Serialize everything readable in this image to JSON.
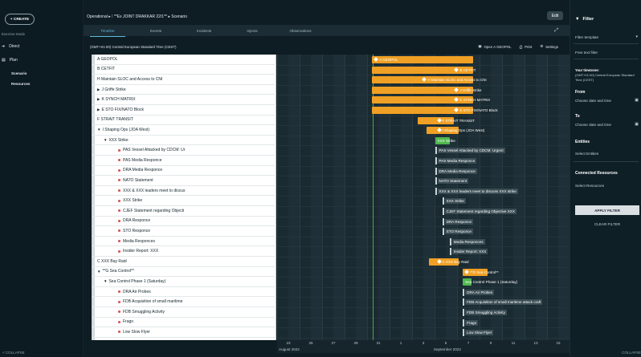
{
  "nav": {
    "create_label": "+ CREATE",
    "exercise_mode": "Exercise Mode",
    "items": [
      {
        "label": "Direct",
        "icon": "arrow-icon"
      },
      {
        "label": "Plan",
        "icon": "clipboard-icon"
      }
    ],
    "sub_items": [
      "Scenario",
      "Resources"
    ],
    "collapse": "< COLLAPSE"
  },
  "header": {
    "breadcrumb": "Operational  ▸  ⁞  **Ex JOINT DRAKKAR 22/1**  ▸  Scenario",
    "edit": "Edit"
  },
  "tabs": [
    "Timeline",
    "Events",
    "Incidents",
    "Injects",
    "Observations"
  ],
  "toolbar": {
    "timezone": "(GMT+01:00) Central European Standard Time (CEST)",
    "open_geopol": "Open A GEOPOL",
    "print": "Print",
    "settings": "Settings"
  },
  "rows": [
    {
      "label": "A GEOPOL",
      "indent": 0,
      "type": "plain"
    },
    {
      "label": "B CETFIT",
      "indent": 0,
      "type": "plain"
    },
    {
      "label": "H Maintain SLOC and Access to CNI",
      "indent": 0,
      "type": "plain"
    },
    {
      "label": "J Griffe Strike",
      "indent": 0,
      "type": "collapsed"
    },
    {
      "label": "K SYNCH MATRIX",
      "indent": 0,
      "type": "collapsed"
    },
    {
      "label": "E STO FIX/NATO Block",
      "indent": 0,
      "type": "collapsed"
    },
    {
      "label": "F STRAIT TRANSIT",
      "indent": 0,
      "type": "plain"
    },
    {
      "label": "I Shaping Ops (JOA West)",
      "indent": 0,
      "type": "expanded"
    },
    {
      "label": "XXX Strike",
      "indent": 1,
      "type": "expanded"
    },
    {
      "label": "PAS Vessel Attacked by CDCM: Ur",
      "indent": 2,
      "type": "dot"
    },
    {
      "label": "PAS Media Responce",
      "indent": 2,
      "type": "dot"
    },
    {
      "label": "DRA Media Responce",
      "indent": 2,
      "type": "dot"
    },
    {
      "label": "NATO Statement",
      "indent": 2,
      "type": "dot"
    },
    {
      "label": "XXX & XXX leaders meet to discus",
      "indent": 2,
      "type": "dot"
    },
    {
      "label": "XXX Strike",
      "indent": 2,
      "type": "dot"
    },
    {
      "label": "CJEF Statement regarding Objecti",
      "indent": 2,
      "type": "dot"
    },
    {
      "label": "DRA Responce",
      "indent": 2,
      "type": "dot"
    },
    {
      "label": "STO Responce",
      "indent": 2,
      "type": "dot"
    },
    {
      "label": "Media Responces",
      "indent": 2,
      "type": "dot"
    },
    {
      "label": "Insider Report: XXX",
      "indent": 2,
      "type": "dot"
    },
    {
      "label": "C XXX Bay Raid",
      "indent": 0,
      "type": "plain"
    },
    {
      "label": "**G Sea Control**",
      "indent": 0,
      "type": "expanded"
    },
    {
      "label": "Sea Control Phase 1 (Saturday)",
      "indent": 1,
      "type": "expanded"
    },
    {
      "label": "DRA Air Probes",
      "indent": 2,
      "type": "dot"
    },
    {
      "label": "FDB Acquisition of small maritime",
      "indent": 2,
      "type": "dot"
    },
    {
      "label": "FDB Smuggling Activity",
      "indent": 2,
      "type": "dot"
    },
    {
      "label": "Frago",
      "indent": 2,
      "type": "dot"
    },
    {
      "label": "Low Slow Flyer",
      "indent": 2,
      "type": "dot"
    }
  ],
  "bars": [
    {
      "row": 0,
      "start": 0.325,
      "end": 0.67,
      "kind": "bar",
      "label": "A GEOPOL"
    },
    {
      "row": 1,
      "start": 0.325,
      "end": 0.67,
      "kind": "bar",
      "label": "B CETFIT",
      "label_at": 0.6
    },
    {
      "row": 2,
      "start": 0.325,
      "end": 0.67,
      "kind": "bar",
      "label": "H Maintain SLOC and Access to CNI",
      "label_at": 0.49
    },
    {
      "row": 3,
      "start": 0.325,
      "end": 0.67,
      "kind": "bar",
      "label": "J Griffe Strike",
      "label_at": 0.6
    },
    {
      "row": 4,
      "start": 0.325,
      "end": 0.67,
      "kind": "bar",
      "label": "K SYNCH MATRIX",
      "label_at": 0.6
    },
    {
      "row": 5,
      "start": 0.325,
      "end": 0.67,
      "kind": "bar",
      "label": "E STO FIX/NATO Block",
      "label_at": 0.6
    },
    {
      "row": 6,
      "start": 0.48,
      "end": 0.605,
      "kind": "bar",
      "label": "F STRAIT TRANSIT",
      "label_at": 0.54
    },
    {
      "row": 7,
      "start": 0.51,
      "end": 0.62,
      "kind": "bar",
      "label": "I Shaping Ops (JOA West)",
      "label_at": 0.54
    },
    {
      "row": 8,
      "start": 0.54,
      "end": 0.59,
      "kind": "green",
      "label": "XXX Strike"
    },
    {
      "row": 9,
      "start": 0.54,
      "kind": "event",
      "label": "PAS Vessel Attacked by CDCM: Urgent"
    },
    {
      "row": 10,
      "start": 0.54,
      "kind": "event",
      "label": "PAS Media Responce"
    },
    {
      "row": 11,
      "start": 0.54,
      "kind": "event",
      "label": "DRA Media Responce"
    },
    {
      "row": 12,
      "start": 0.54,
      "kind": "event",
      "label": "NATO Statement"
    },
    {
      "row": 13,
      "start": 0.54,
      "kind": "event",
      "label": "XXX & XXX leaders meet to discuss XXX strike"
    },
    {
      "row": 14,
      "start": 0.565,
      "kind": "event",
      "label": "XXX Strike"
    },
    {
      "row": 15,
      "start": 0.565,
      "kind": "event",
      "label": "CJEF Statement regarding Objective XXX"
    },
    {
      "row": 16,
      "start": 0.565,
      "kind": "event",
      "label": "DRA Responce"
    },
    {
      "row": 17,
      "start": 0.565,
      "kind": "event",
      "label": "STO Responce"
    },
    {
      "row": 18,
      "start": 0.59,
      "kind": "event",
      "label": "Media Responces"
    },
    {
      "row": 19,
      "start": 0.59,
      "kind": "event",
      "label": "Insider Report: XXX"
    },
    {
      "row": 20,
      "start": 0.52,
      "end": 0.62,
      "kind": "bar",
      "label": "C XXX Bay Raid",
      "label_at": 0.54
    },
    {
      "row": 21,
      "start": 0.635,
      "end": 0.72,
      "kind": "bar",
      "label": "**G Sea Control**"
    },
    {
      "row": 22,
      "start": 0.635,
      "end": 0.665,
      "kind": "green",
      "label": "Sea Control Phase 1 (Saturday)"
    },
    {
      "row": 23,
      "start": 0.635,
      "kind": "event",
      "label": "DRA Air Probes"
    },
    {
      "row": 24,
      "start": 0.635,
      "kind": "event",
      "label": "FDB Acquisition of small maritime attack craft"
    },
    {
      "row": 25,
      "start": 0.635,
      "kind": "event",
      "label": "FDB Smuggling Activity"
    },
    {
      "row": 26,
      "start": 0.635,
      "kind": "event",
      "label": "Frago"
    },
    {
      "row": 27,
      "start": 0.635,
      "kind": "event",
      "label": "Low Slow Flyer"
    }
  ],
  "axis": {
    "ticks": [
      "23",
      "25",
      "27",
      "29",
      "31",
      "1",
      "3",
      "5",
      "7",
      "9",
      "11",
      "13",
      "15"
    ],
    "months": [
      "August 2022",
      "September 2022"
    ]
  },
  "filter": {
    "title": "Filter",
    "template": "Filter template",
    "free_text": "Free text filter",
    "timezone_label": "Your timezone:",
    "timezone_value": "(GMT+01:00) Central European Standard Time (CEST)",
    "from": "From",
    "from_placeholder": "Choose date and time",
    "to": "To",
    "to_placeholder": "Choose date and time",
    "entities": "Entities",
    "entities_placeholder": "Select Entities",
    "connected": "Connected Resources",
    "connected_placeholder": "Select Resources",
    "apply": "APPLY FILTER",
    "clear": "CLEAR FILTER",
    "collapse": "COLLAPSE"
  },
  "colors": {
    "bar": "#f0a024",
    "green": "#4fb84f",
    "accent": "#5fb8d8",
    "dot": "#d94f4f"
  }
}
